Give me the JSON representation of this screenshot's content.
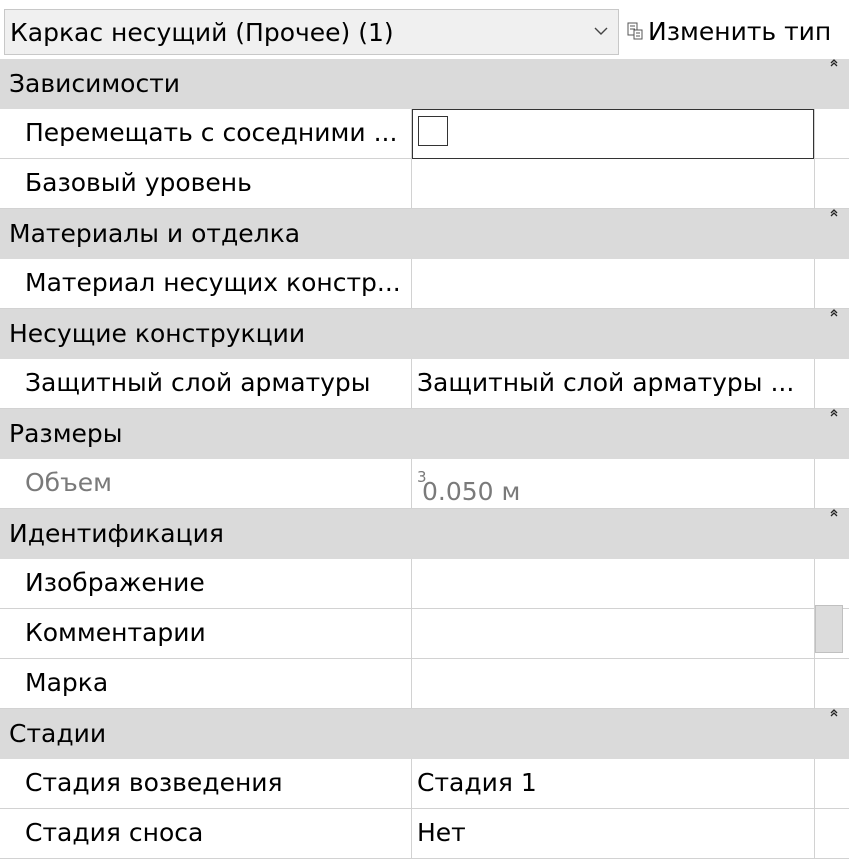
{
  "header": {
    "type_selector": "Каркас несущий (Прочее) (1)",
    "edit_type_label": "Изменить тип"
  },
  "groups": {
    "dependencies": {
      "title": "Зависимости",
      "move_with_neighbors": {
        "name": "Перемещать с соседними ...",
        "checked": false
      },
      "base_level": {
        "name": "Базовый уровень",
        "value": ""
      }
    },
    "materials": {
      "title": "Материалы и отделка",
      "structural_material": {
        "name": "Материал несущих констр...",
        "value": ""
      }
    },
    "structural": {
      "title": "Несущие конструкции",
      "rebar_cover": {
        "name": "Защитный слой арматуры",
        "value": "Защитный слой арматуры ..."
      }
    },
    "dimensions": {
      "title": "Размеры",
      "volume": {
        "name": "Объем",
        "value": "0.050 м",
        "unit_superscript": "3"
      }
    },
    "identity": {
      "title": "Идентификация",
      "image": {
        "name": "Изображение",
        "value": ""
      },
      "comments": {
        "name": "Комментарии",
        "value": ""
      },
      "mark": {
        "name": "Марка",
        "value": ""
      }
    },
    "phasing": {
      "title": "Стадии",
      "phase_created": {
        "name": "Стадия возведения",
        "value": "Стадия 1"
      },
      "phase_demolished": {
        "name": "Стадия сноса",
        "value": "Нет"
      }
    }
  },
  "icons": {
    "dropdown": "chevron-down-icon",
    "edit_type": "edit-type-icon",
    "collapse": "collapse-icon"
  }
}
